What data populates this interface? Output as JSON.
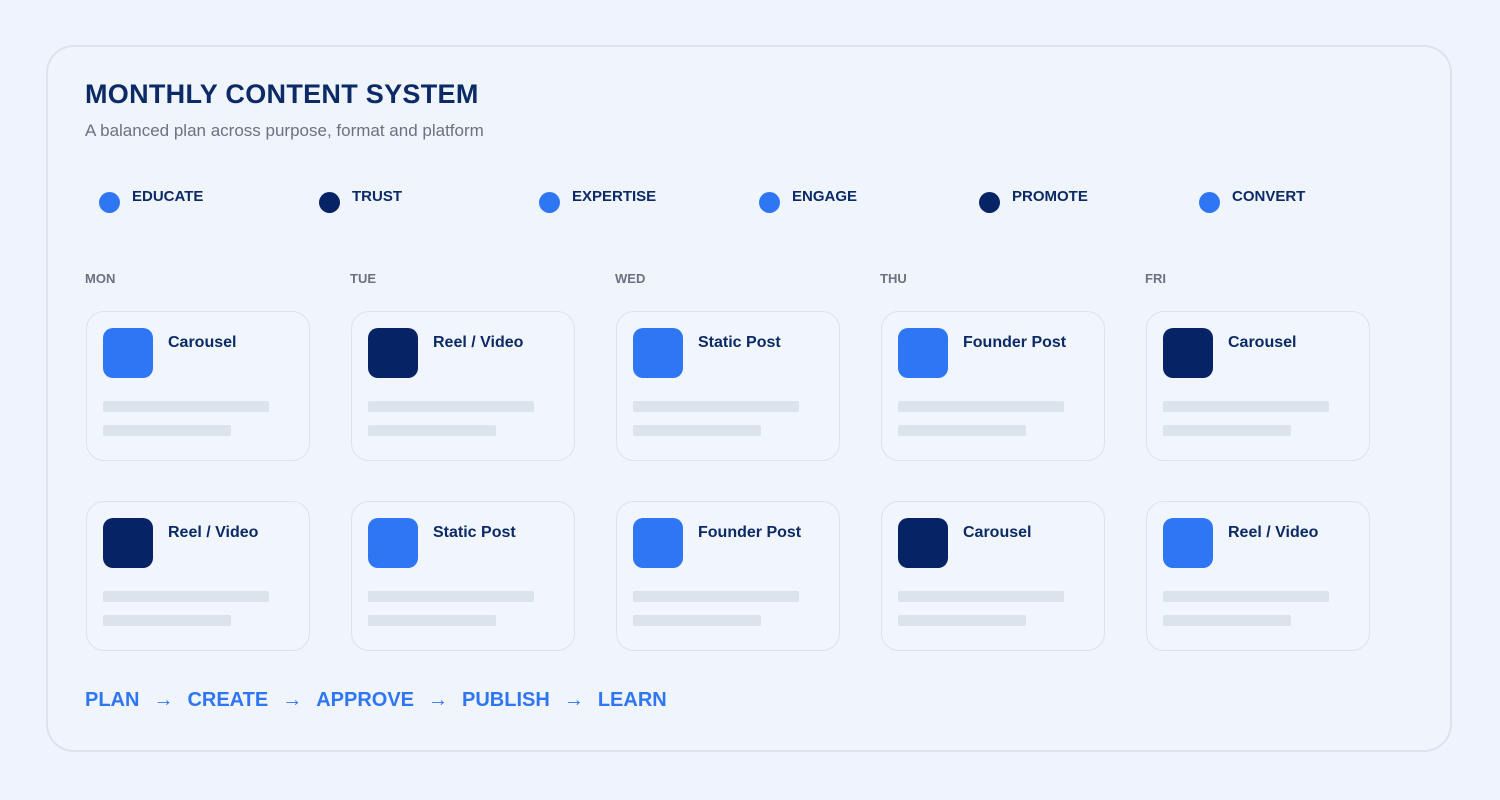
{
  "colors": {
    "accent_blue": "#2f76f5",
    "navy": "#062366"
  },
  "header": {
    "title": "MONTHLY CONTENT SYSTEM",
    "subtitle": "A balanced plan across purpose, format and platform"
  },
  "legend": [
    {
      "label": "EDUCATE",
      "color": "#2f76f5"
    },
    {
      "label": "TRUST",
      "color": "#062366"
    },
    {
      "label": "EXPERTISE",
      "color": "#2f76f5"
    },
    {
      "label": "ENGAGE",
      "color": "#2f76f5"
    },
    {
      "label": "PROMOTE",
      "color": "#062366"
    },
    {
      "label": "CONVERT",
      "color": "#2f76f5"
    }
  ],
  "days": [
    {
      "label": "MON",
      "cards": [
        {
          "title": "Carousel",
          "color": "#2f76f5"
        },
        {
          "title": "Reel / Video",
          "color": "#062366"
        }
      ]
    },
    {
      "label": "TUE",
      "cards": [
        {
          "title": "Reel / Video",
          "color": "#062366"
        },
        {
          "title": "Static Post",
          "color": "#2f76f5"
        }
      ]
    },
    {
      "label": "WED",
      "cards": [
        {
          "title": "Static Post",
          "color": "#2f76f5"
        },
        {
          "title": "Founder Post",
          "color": "#2f76f5"
        }
      ]
    },
    {
      "label": "THU",
      "cards": [
        {
          "title": "Founder Post",
          "color": "#2f76f5"
        },
        {
          "title": "Carousel",
          "color": "#062366"
        }
      ]
    },
    {
      "label": "FRI",
      "cards": [
        {
          "title": "Carousel",
          "color": "#062366"
        },
        {
          "title": "Reel / Video",
          "color": "#2f76f5"
        }
      ]
    }
  ],
  "workflow": {
    "steps": [
      "PLAN",
      "CREATE",
      "APPROVE",
      "PUBLISH",
      "LEARN"
    ],
    "separator": "→"
  }
}
